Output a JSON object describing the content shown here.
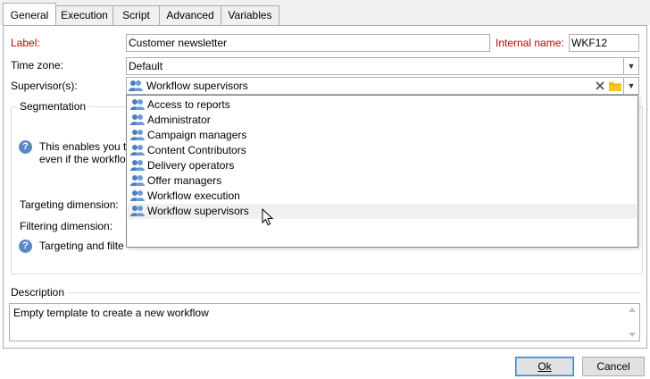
{
  "tabs": [
    {
      "label": "General"
    },
    {
      "label": "Execution"
    },
    {
      "label": "Script"
    },
    {
      "label": "Advanced"
    },
    {
      "label": "Variables"
    }
  ],
  "form": {
    "label_caption": "Label:",
    "label_value": "Customer newsletter",
    "internal_name_caption": "Internal name:",
    "internal_name_value": "WKF12",
    "timezone_caption": "Time zone:",
    "timezone_value": "Default",
    "supervisors_caption": "Supervisor(s):",
    "supervisors_value": "Workflow supervisors"
  },
  "segmentation": {
    "title": "Segmentation",
    "help_line1": "This enables you t",
    "help_line2": "even if the workflo",
    "targeting_caption": "Targeting dimension:",
    "filtering_caption": "Filtering dimension:",
    "help2_text": "Targeting and filte"
  },
  "dropdown": {
    "items": [
      {
        "label": "Access to reports"
      },
      {
        "label": "Administrator"
      },
      {
        "label": "Campaign managers"
      },
      {
        "label": "Content Contributors"
      },
      {
        "label": "Delivery operators"
      },
      {
        "label": "Offer managers"
      },
      {
        "label": "Workflow execution"
      },
      {
        "label": "Workflow supervisors"
      }
    ],
    "selected_index": 7
  },
  "description": {
    "title": "Description",
    "value": "Empty template to create a new workflow"
  },
  "buttons": {
    "ok_label": "Ok",
    "cancel_label": "Cancel"
  },
  "colors": {
    "required_label": "#c00000",
    "accent": "#3c7fb1"
  }
}
